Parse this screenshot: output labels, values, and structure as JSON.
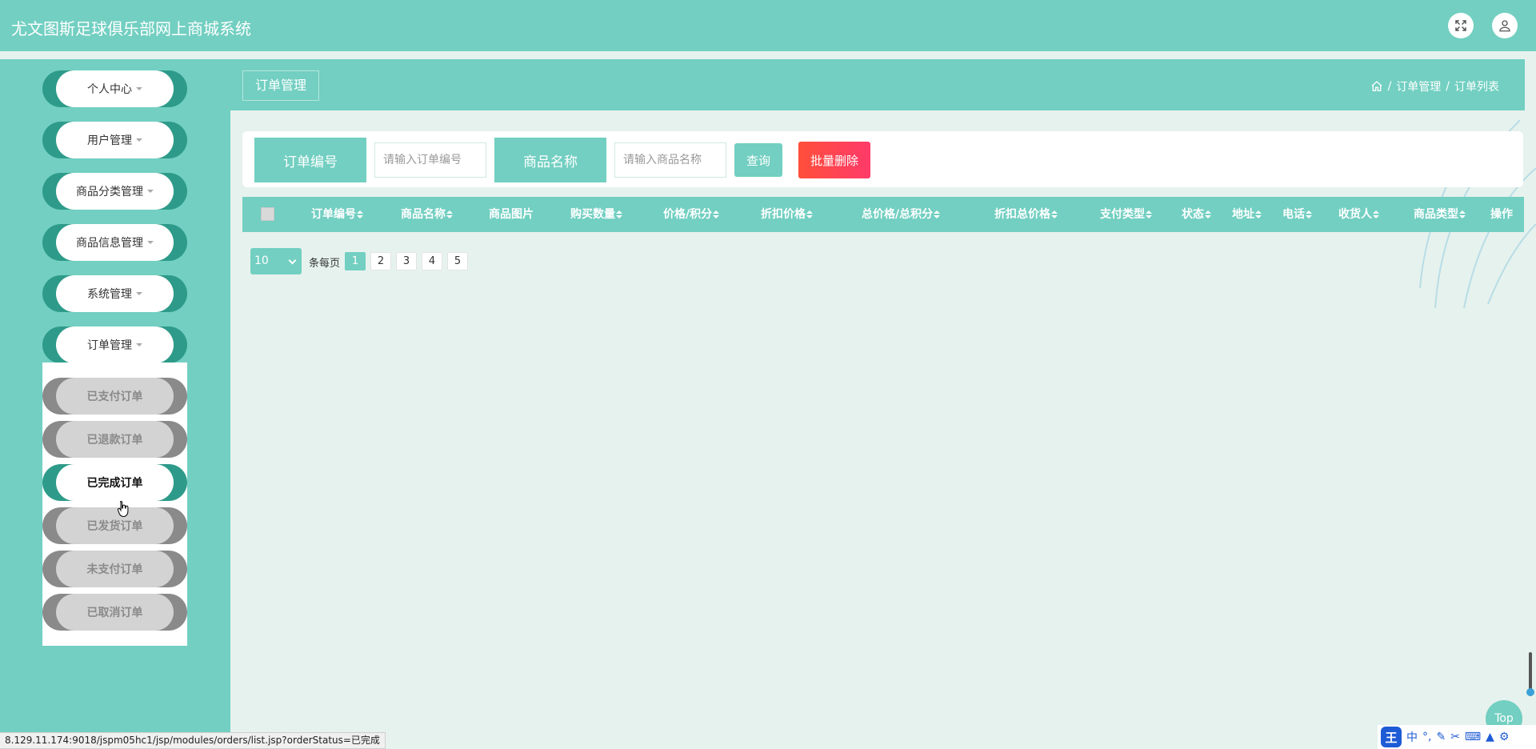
{
  "header": {
    "app_title": "尤文图斯足球俱乐部网上商城系统",
    "icons": [
      "expand-icon",
      "user-icon"
    ]
  },
  "sidebar": {
    "menus": [
      {
        "label": "个人中心"
      },
      {
        "label": "用户管理"
      },
      {
        "label": "商品分类管理"
      },
      {
        "label": "商品信息管理"
      },
      {
        "label": "系统管理"
      },
      {
        "label": "订单管理"
      }
    ],
    "submenu": [
      {
        "label": "已支付订单",
        "active": false
      },
      {
        "label": "已退款订单",
        "active": false
      },
      {
        "label": "已完成订单",
        "active": true
      },
      {
        "label": "已发货订单",
        "active": false
      },
      {
        "label": "未支付订单",
        "active": false
      },
      {
        "label": "已取消订单",
        "active": false
      }
    ]
  },
  "content": {
    "page_tab": "订单管理",
    "breadcrumb": {
      "level1": "订单管理",
      "level2": "订单列表",
      "sep": "/"
    }
  },
  "search": {
    "order_no_label": "订单编号",
    "order_no_placeholder": "请输入订单编号",
    "product_label": "商品名称",
    "product_placeholder": "请输入商品名称",
    "query_button": "查询",
    "batch_delete_button": "批量删除"
  },
  "table": {
    "columns": [
      {
        "label": "订单编号",
        "sortable": true
      },
      {
        "label": "商品名称",
        "sortable": true
      },
      {
        "label": "商品图片",
        "sortable": false
      },
      {
        "label": "购买数量",
        "sortable": true
      },
      {
        "label": "价格/积分",
        "sortable": true
      },
      {
        "label": "折扣价格",
        "sortable": true
      },
      {
        "label": "总价格/总积分",
        "sortable": true
      },
      {
        "label": "折扣总价格",
        "sortable": true
      },
      {
        "label": "支付类型",
        "sortable": true
      },
      {
        "label": "状态",
        "sortable": true
      },
      {
        "label": "地址",
        "sortable": true
      },
      {
        "label": "电话",
        "sortable": true
      },
      {
        "label": "收货人",
        "sortable": true
      },
      {
        "label": "商品类型",
        "sortable": true
      },
      {
        "label": "操作",
        "sortable": false
      }
    ],
    "rows": []
  },
  "pagination": {
    "page_size": "10",
    "per_page_label": "条每页",
    "pages": [
      "1",
      "2",
      "3",
      "4",
      "5"
    ],
    "current_page": "1"
  },
  "floating": {
    "top_button": "Top"
  },
  "browser": {
    "status_url": "8.129.11.174:9018/jspm05hc1/jsp/modules/orders/list.jsp?orderStatus=已完成",
    "ime_logo": "王",
    "ime_mode": "中"
  },
  "colors": {
    "accent": "#72cfc1",
    "accent_dark": "#2e9b8a",
    "danger": "#ff4f3a",
    "background": "#e6f2ee"
  }
}
